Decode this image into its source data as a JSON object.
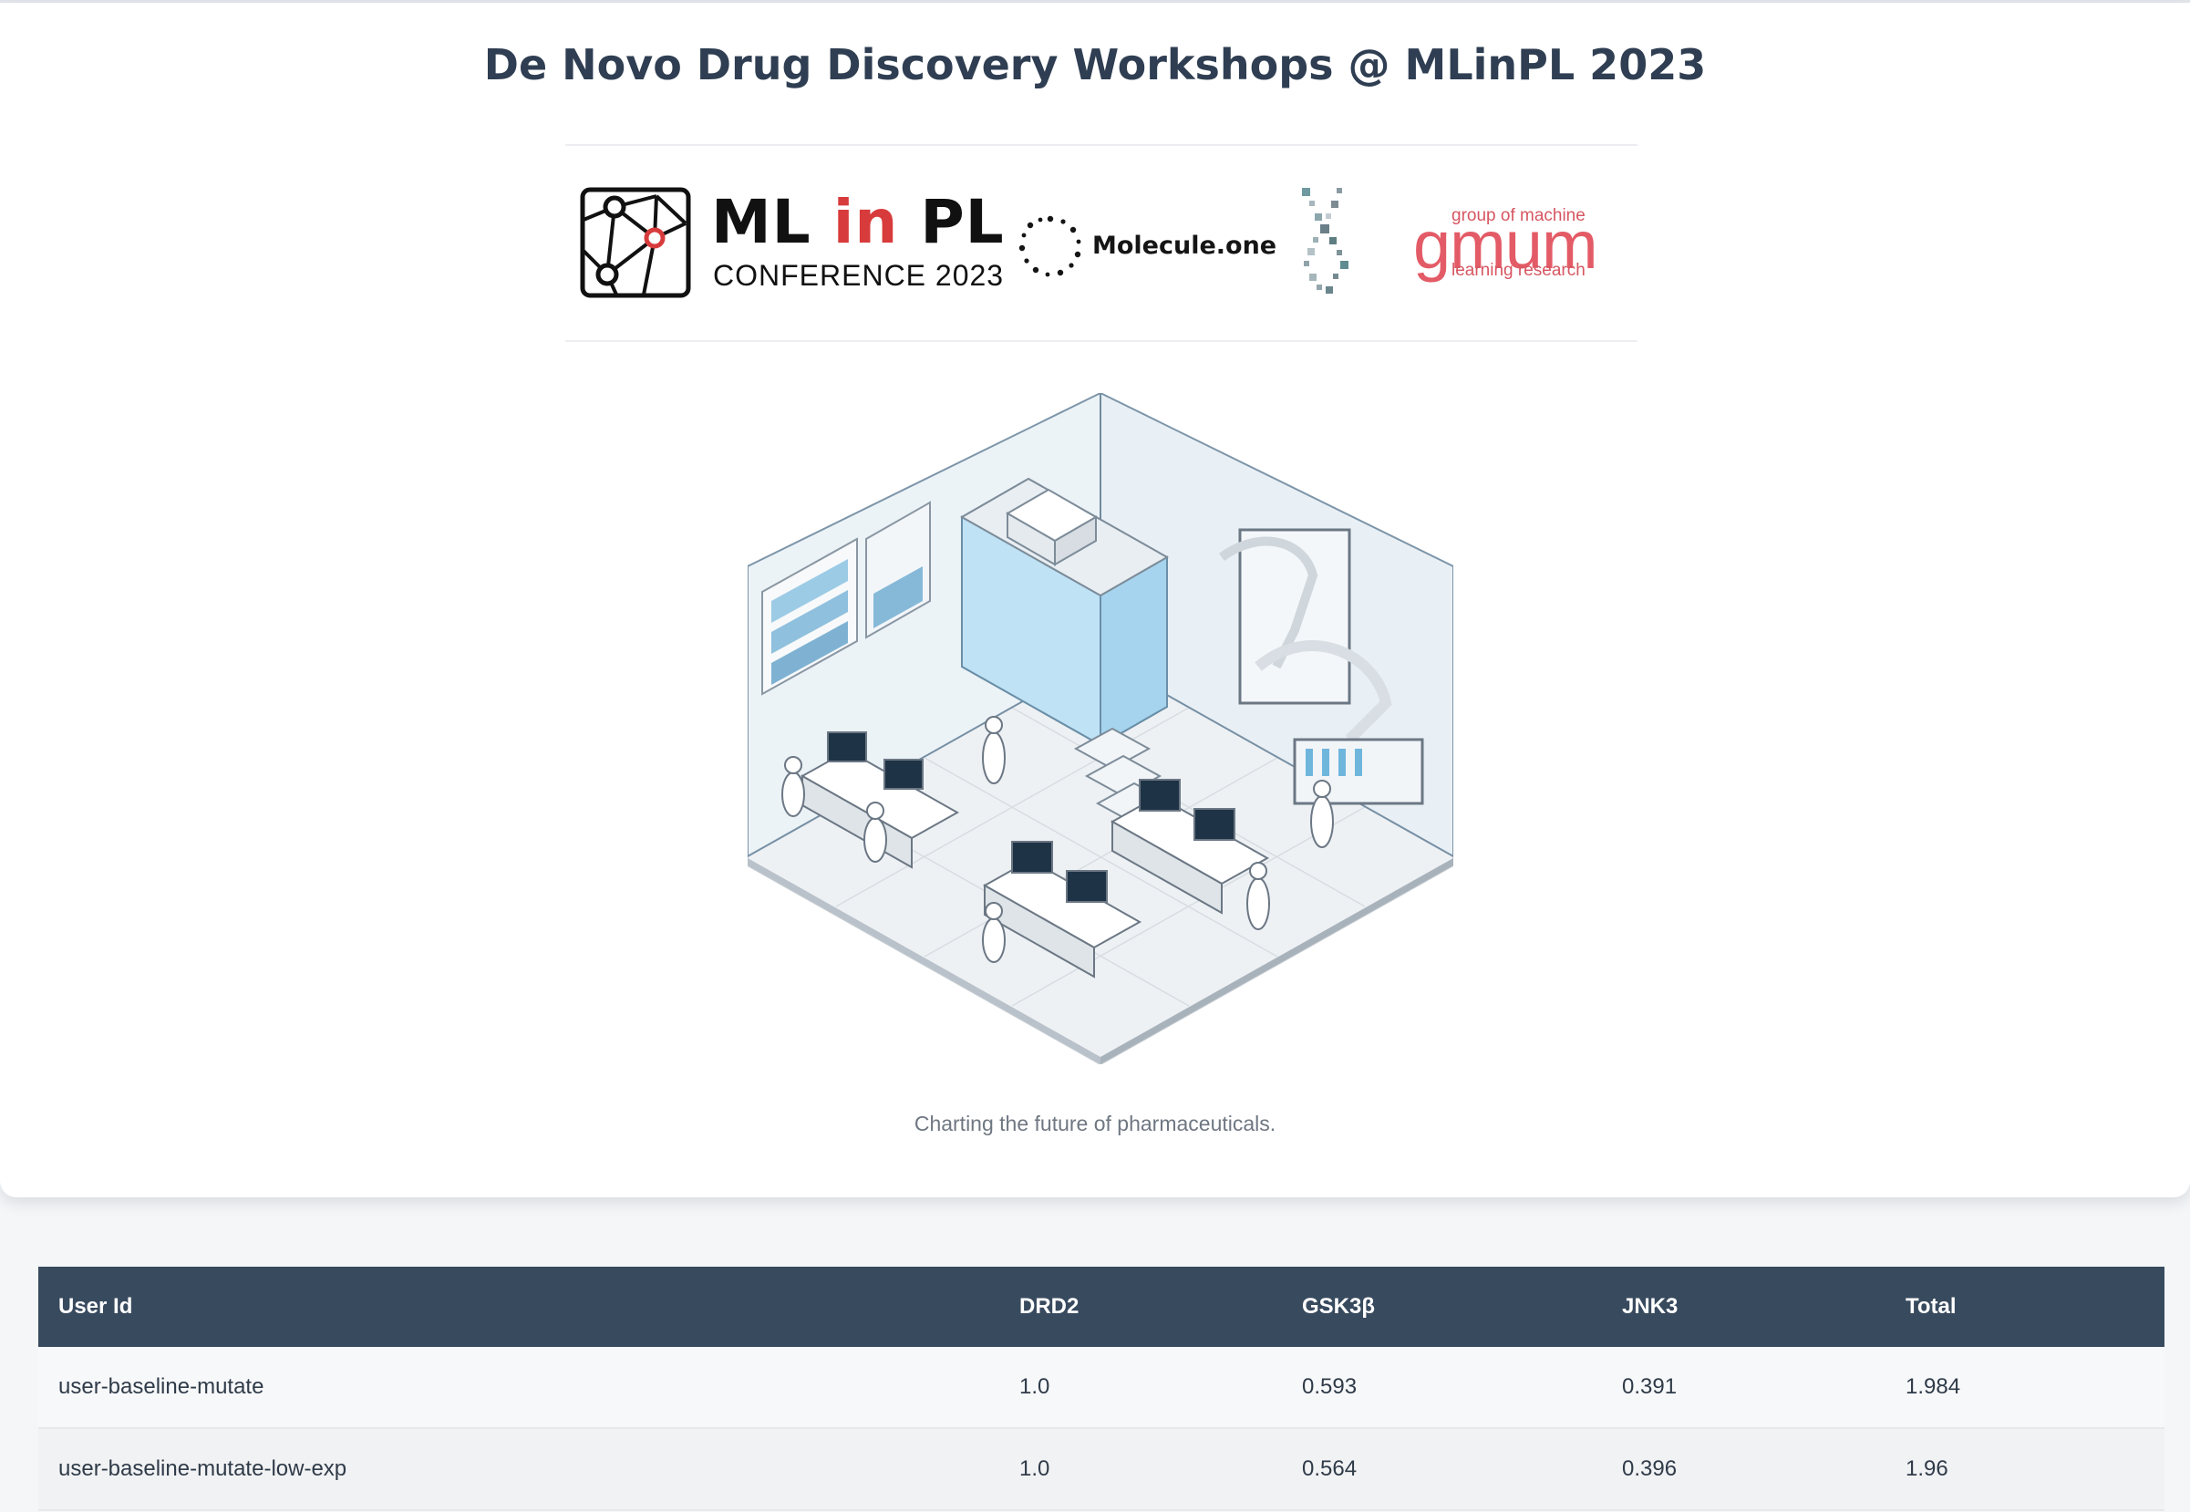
{
  "page": {
    "title": "De Novo Drug Discovery Workshops @ MLinPL 2023",
    "tagline": "Charting the future of pharmaceuticals."
  },
  "logos": {
    "mlinpl": {
      "word_ml": "ML",
      "word_in": "in",
      "word_pl": "PL",
      "subtitle": "CONFERENCE 2023"
    },
    "molecule_one": {
      "text": "Molecule.one"
    },
    "gmum": {
      "top": "group of machine",
      "word": "gmum",
      "bottom": "learning research"
    }
  },
  "hero_image": {
    "description_icon": "isometric-lab-illustration"
  },
  "table": {
    "columns": [
      "User Id",
      "DRD2",
      "GSK3β",
      "JNK3",
      "Total"
    ],
    "rows": [
      [
        "user-baseline-mutate",
        "1.0",
        "0.593",
        "0.391",
        "1.984"
      ],
      [
        "user-baseline-mutate-low-exp",
        "1.0",
        "0.564",
        "0.396",
        "1.96"
      ]
    ]
  },
  "colors": {
    "title": "#2f3e52",
    "table_header_bg": "#384a5e",
    "mlinpl_accent": "#d83b3b",
    "gmum_red": "#e35b66",
    "page_bg": "#f4f6f8"
  }
}
